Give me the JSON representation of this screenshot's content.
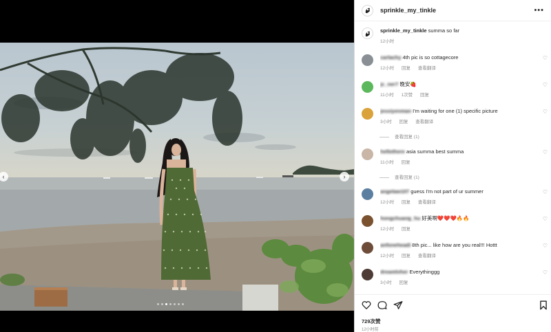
{
  "post": {
    "username": "sprinkle_my_tinkle",
    "caption_user": "sprinkle_my_tinkle",
    "caption_text": "summa so far",
    "caption_time": "12小时",
    "more_icon": "more-horizontal-icon"
  },
  "carousel": {
    "prev_icon": "‹",
    "next_icon": "›",
    "slide_count": 7,
    "active_index": 2
  },
  "comments": [
    {
      "user": "carlachy",
      "text": "4th pic is so cottagecore",
      "time": "12小时",
      "reply": "回复",
      "translate": "查看翻译",
      "avatar_color": "#8a8f96"
    },
    {
      "user": "jc_ner7",
      "text": "晚安🍓",
      "time": "11小时",
      "likes": "1次赞",
      "reply": "回复",
      "avatar_color": "#5cb85c"
    },
    {
      "user": "jessiyenman",
      "text": "I'm waiting for one (1) specific picture",
      "time": "3小时",
      "reply": "回复",
      "translate": "查看翻译",
      "view_replies": "查看回复 (1)",
      "avatar_color": "#d9a23a"
    },
    {
      "user": "hellothere",
      "text": "asia summa best summa",
      "time": "11小时",
      "reply": "回复",
      "view_replies": "查看回复 (1)",
      "avatar_color": "#c9b6a6"
    },
    {
      "user": "angelaw107",
      "text": "guess I'm not part of ur summer",
      "time": "12小时",
      "reply": "回复",
      "translate": "查看翻译",
      "avatar_color": "#5b7fa0"
    },
    {
      "user": "hongchuang_hu",
      "text": "好美啊❤️❤️❤️🔥🔥",
      "time": "12小时",
      "reply": "回复",
      "avatar_color": "#7a5230"
    },
    {
      "user": "anfoneheadi",
      "text": "8th pic... like how are you real!!! Hottt",
      "time": "12小时",
      "reply": "回复",
      "translate": "查看翻译",
      "avatar_color": "#6e4c3a"
    },
    {
      "user": "dreamlvher",
      "text": "Everythinggg",
      "time": "3小时",
      "reply": "回复",
      "avatar_color": "#4e3b35"
    }
  ],
  "footer": {
    "likes": "729次赞",
    "time": "12小时前"
  },
  "colors": {
    "text": "#262626",
    "secondary": "#8e8e8e",
    "border": "#dbdbdb"
  }
}
